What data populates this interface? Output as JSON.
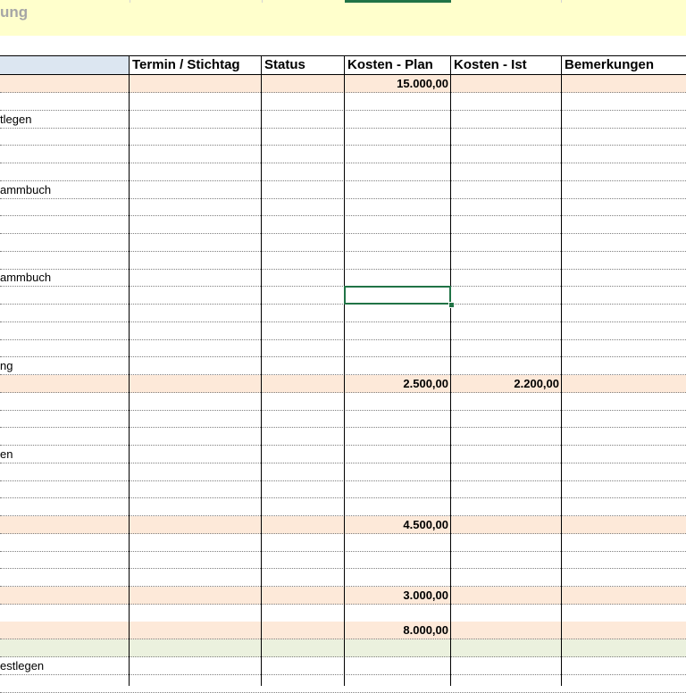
{
  "banner": {
    "title": "ung"
  },
  "columns": [
    {
      "id": "task",
      "label": ""
    },
    {
      "id": "termin",
      "label": "Termin / Stichtag"
    },
    {
      "id": "status",
      "label": "Status"
    },
    {
      "id": "plan",
      "label": "Kosten - Plan"
    },
    {
      "id": "ist",
      "label": "Kosten - Ist"
    },
    {
      "id": "bemerkungen",
      "label": "Bemerkungen"
    }
  ],
  "rows": [
    {
      "kind": "section",
      "label": "",
      "plan": "15.000,00",
      "ist": ""
    },
    {
      "kind": "task",
      "label": ""
    },
    {
      "kind": "task",
      "label": "tlegen"
    },
    {
      "kind": "task",
      "label": ""
    },
    {
      "kind": "task",
      "label": ""
    },
    {
      "kind": "task",
      "label": ""
    },
    {
      "kind": "task",
      "label": "ammbuch"
    },
    {
      "kind": "task",
      "label": ""
    },
    {
      "kind": "task",
      "label": ""
    },
    {
      "kind": "task",
      "label": ""
    },
    {
      "kind": "task",
      "label": ""
    },
    {
      "kind": "task",
      "label": "ammbuch"
    },
    {
      "kind": "task",
      "label": ""
    },
    {
      "kind": "task",
      "label": ""
    },
    {
      "kind": "task",
      "label": ""
    },
    {
      "kind": "task",
      "label": ""
    },
    {
      "kind": "task",
      "label": "ng"
    },
    {
      "kind": "section",
      "label": "",
      "plan": "2.500,00",
      "ist": "2.200,00"
    },
    {
      "kind": "task",
      "label": ""
    },
    {
      "kind": "task",
      "label": ""
    },
    {
      "kind": "task",
      "label": ""
    },
    {
      "kind": "task",
      "label": "en"
    },
    {
      "kind": "task",
      "label": ""
    },
    {
      "kind": "task",
      "label": ""
    },
    {
      "kind": "task",
      "label": ""
    },
    {
      "kind": "section",
      "label": "",
      "plan": "4.500,00",
      "ist": ""
    },
    {
      "kind": "task",
      "label": ""
    },
    {
      "kind": "task",
      "label": ""
    },
    {
      "kind": "task",
      "label": ""
    },
    {
      "kind": "section",
      "label": "",
      "plan": "3.000,00",
      "ist": ""
    },
    {
      "kind": "task",
      "label": ""
    },
    {
      "kind": "section",
      "label": "",
      "plan": "8.000,00",
      "ist": ""
    },
    {
      "kind": "green",
      "label": ""
    },
    {
      "kind": "task",
      "label": "estlegen"
    },
    {
      "kind": "task",
      "label": ""
    }
  ]
}
